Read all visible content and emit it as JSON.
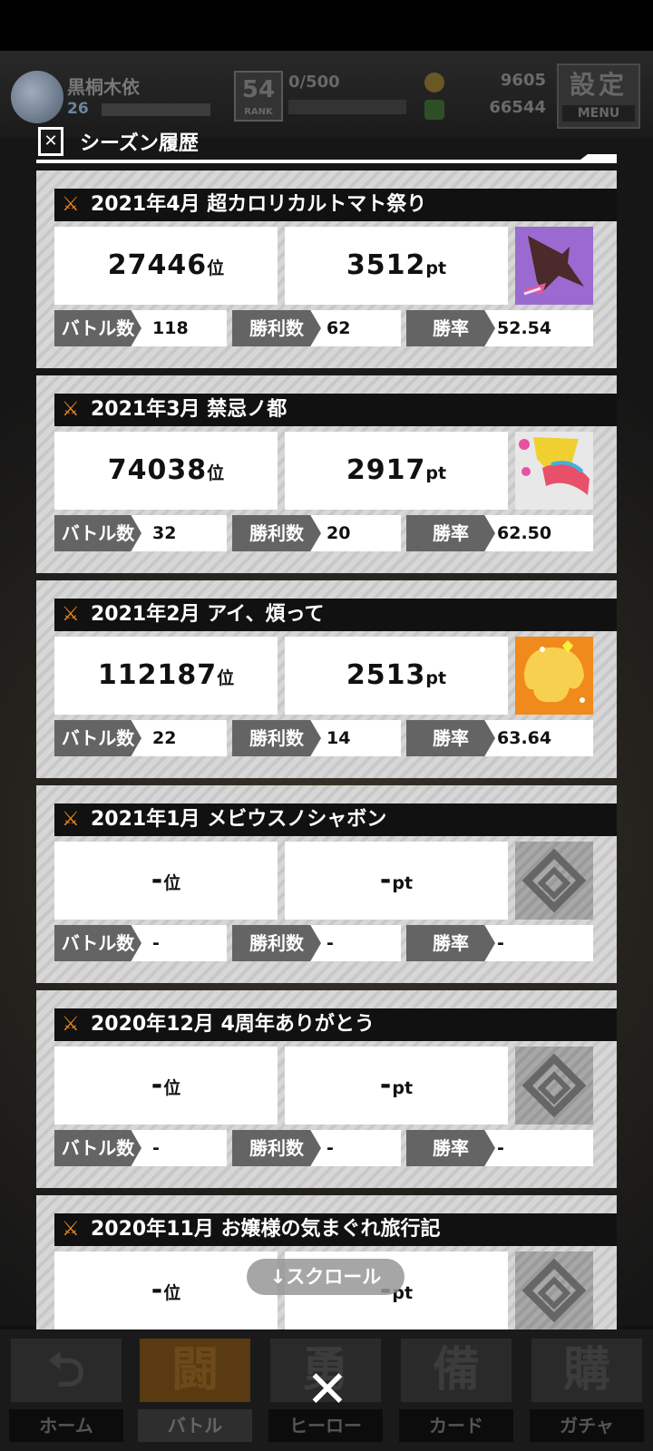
{
  "player": {
    "name": "黒桐木依",
    "level": "26"
  },
  "rank": {
    "badge": "54",
    "badge_sub": "RANK",
    "exp": "0/500"
  },
  "currency": {
    "coins": "9605",
    "gems": "66544",
    "coin_color": "#c8962a",
    "gem_color": "#4a8a3a"
  },
  "settings": {
    "label": "設定",
    "sub": "MENU"
  },
  "modal": {
    "title": "シーズン履歴"
  },
  "labels": {
    "battles": "バトル数",
    "wins": "勝利数",
    "rate": "勝率",
    "rank_unit": "位",
    "pt_unit": "pt"
  },
  "seasons": [
    {
      "title": "2021年4月 超カロリカルトマト祭り",
      "rank": "27446",
      "points": "3512",
      "battles": "118",
      "wins": "62",
      "rate": "52.54",
      "thumb": "purple"
    },
    {
      "title": "2021年3月 禁忌ノ都",
      "rank": "74038",
      "points": "2917",
      "battles": "32",
      "wins": "20",
      "rate": "62.50",
      "thumb": "yellow"
    },
    {
      "title": "2021年2月 アイ、煩って",
      "rank": "112187",
      "points": "2513",
      "battles": "22",
      "wins": "14",
      "rate": "63.64",
      "thumb": "orange"
    },
    {
      "title": "2021年1月 メビウスノシャボン",
      "rank": "-",
      "points": "-",
      "battles": "-",
      "wins": "-",
      "rate": "-",
      "thumb": "none"
    },
    {
      "title": "2020年12月 4周年ありがとう",
      "rank": "-",
      "points": "-",
      "battles": "-",
      "wins": "-",
      "rate": "-",
      "thumb": "none"
    },
    {
      "title": "2020年11月 お嬢様の気まぐれ旅行記",
      "rank": "-",
      "points": "-",
      "battles": "-",
      "wins": "-",
      "rate": "-",
      "thumb": "none"
    }
  ],
  "scroll_hint": "↓スクロール",
  "nav": [
    {
      "label": "ホーム",
      "glyph": "⮌"
    },
    {
      "label": "バトル",
      "glyph": "闘"
    },
    {
      "label": "ヒーロー",
      "glyph": "勇"
    },
    {
      "label": "カード",
      "glyph": "備"
    },
    {
      "label": "ガチャ",
      "glyph": "購"
    }
  ],
  "close_glyph": "✕"
}
